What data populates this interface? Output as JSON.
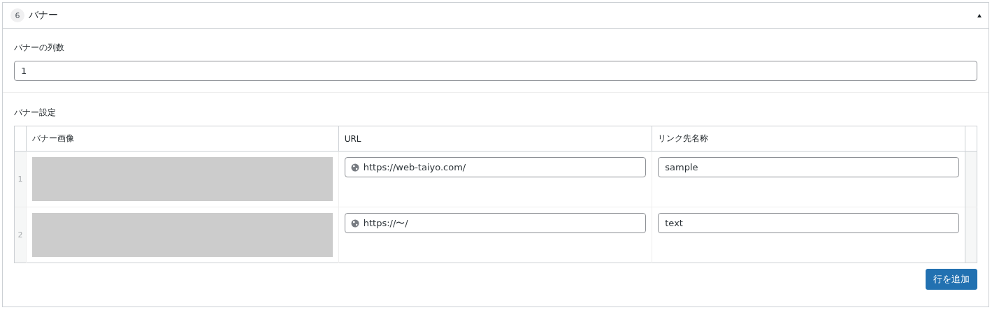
{
  "panel": {
    "number": "6",
    "title": "バナー",
    "expanded": true
  },
  "columns_field": {
    "label": "バナーの列数",
    "value": "1"
  },
  "banner_settings": {
    "label": "バナー設定",
    "table": {
      "columns": [
        "バナー画像",
        "URL",
        "リンク先名称"
      ],
      "rows": [
        {
          "index": "1",
          "url": "https://web-taiyo.com/",
          "link_name": "sample"
        },
        {
          "index": "2",
          "url": "https://〜/",
          "link_name": "text"
        }
      ]
    },
    "add_row_button": "行を追加"
  }
}
